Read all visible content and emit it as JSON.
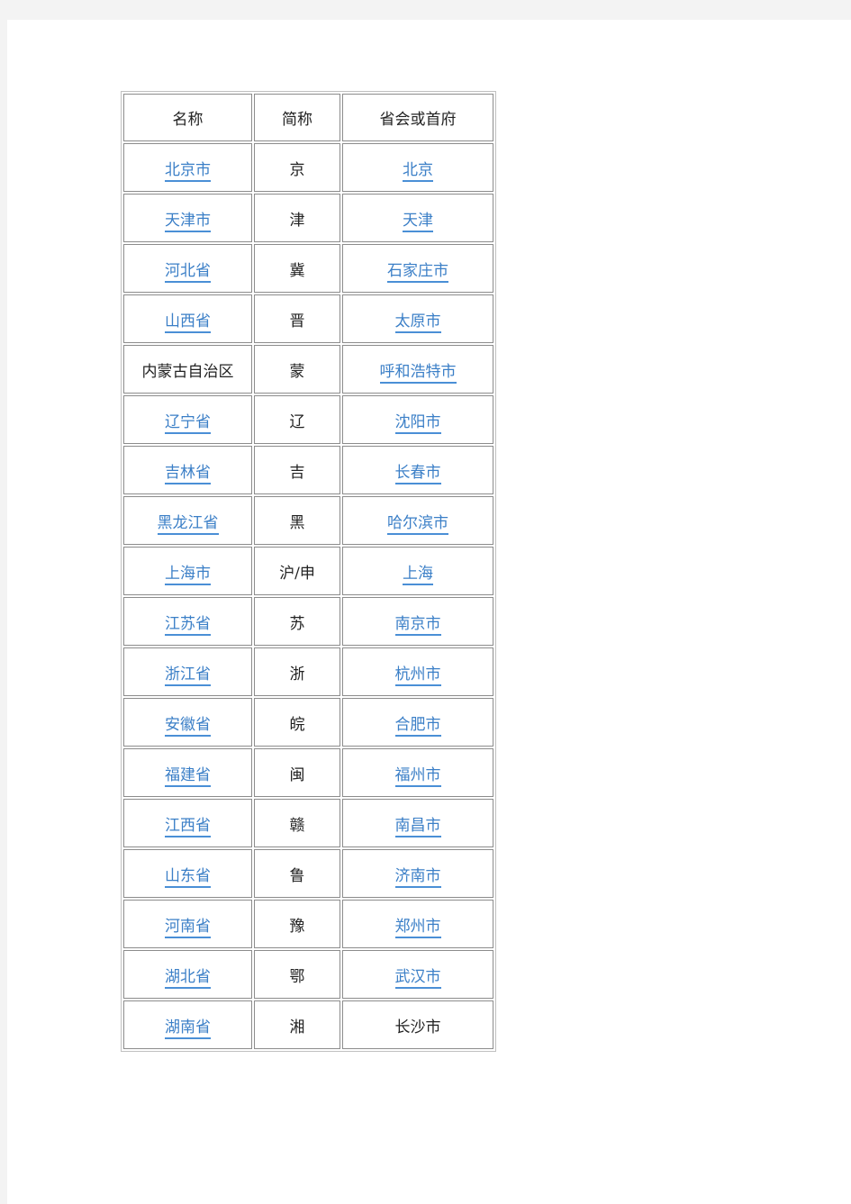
{
  "colors": {
    "link": "#3b7fc7",
    "text": "#222222",
    "border": "#8c8c8c",
    "margin_bg": "#f3f3f3"
  },
  "table": {
    "headers": [
      "名称",
      "简称",
      "省会或首府"
    ],
    "rows": [
      {
        "name": "北京市",
        "name_link": true,
        "abbr": "京",
        "capital": "北京",
        "capital_link": true
      },
      {
        "name": "天津市",
        "name_link": true,
        "abbr": "津",
        "capital": "天津",
        "capital_link": true
      },
      {
        "name": "河北省",
        "name_link": true,
        "abbr": "冀",
        "capital": "石家庄市",
        "capital_link": true
      },
      {
        "name": "山西省",
        "name_link": true,
        "abbr": "晋",
        "capital": "太原市",
        "capital_link": true
      },
      {
        "name": "内蒙古自治区",
        "name_link": false,
        "abbr": "蒙",
        "capital": "呼和浩特市",
        "capital_link": true
      },
      {
        "name": "辽宁省",
        "name_link": true,
        "abbr": "辽",
        "capital": "沈阳市",
        "capital_link": true
      },
      {
        "name": "吉林省",
        "name_link": true,
        "abbr": "吉",
        "capital": "长春市",
        "capital_link": true
      },
      {
        "name": "黑龙江省",
        "name_link": true,
        "abbr": "黑",
        "capital": "哈尔滨市",
        "capital_link": true
      },
      {
        "name": "上海市",
        "name_link": true,
        "abbr": "沪/申",
        "capital": "上海",
        "capital_link": true
      },
      {
        "name": "江苏省",
        "name_link": true,
        "abbr": "苏",
        "capital": "南京市",
        "capital_link": true
      },
      {
        "name": "浙江省",
        "name_link": true,
        "abbr": "浙",
        "capital": "杭州市",
        "capital_link": true
      },
      {
        "name": "安徽省",
        "name_link": true,
        "abbr": "皖",
        "capital": "合肥市",
        "capital_link": true
      },
      {
        "name": "福建省",
        "name_link": true,
        "abbr": "闽",
        "capital": "福州市",
        "capital_link": true
      },
      {
        "name": "江西省",
        "name_link": true,
        "abbr": "赣",
        "capital": "南昌市",
        "capital_link": true
      },
      {
        "name": "山东省",
        "name_link": true,
        "abbr": "鲁",
        "capital": "济南市",
        "capital_link": true
      },
      {
        "name": "河南省",
        "name_link": true,
        "abbr": "豫",
        "capital": "郑州市",
        "capital_link": true
      },
      {
        "name": "湖北省",
        "name_link": true,
        "abbr": "鄂",
        "capital": "武汉市",
        "capital_link": true
      },
      {
        "name": "湖南省",
        "name_link": true,
        "abbr": "湘",
        "capital": "长沙市",
        "capital_link": false
      }
    ]
  }
}
